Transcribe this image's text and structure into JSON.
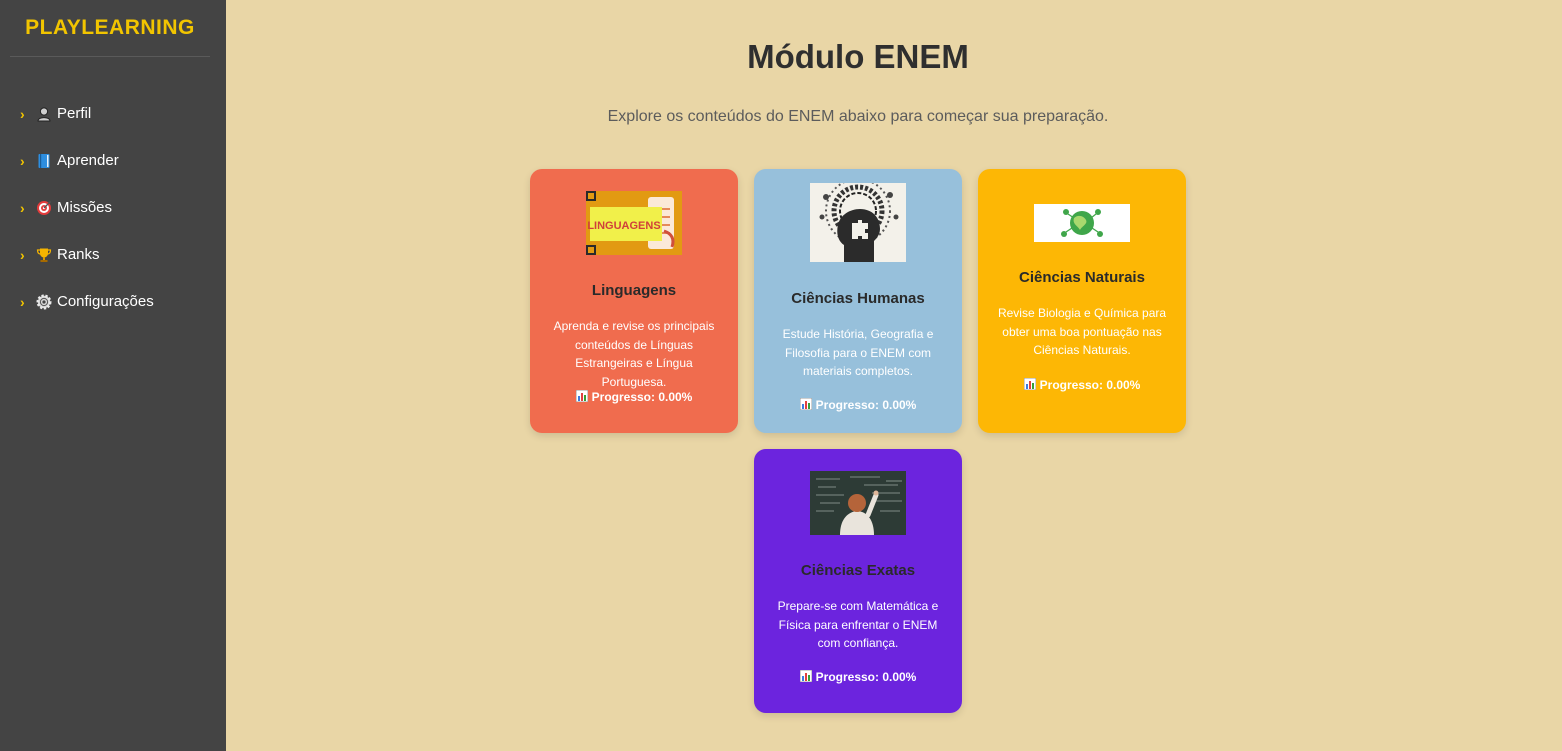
{
  "brand": "PLAYLEARNING",
  "nav": {
    "items": [
      {
        "arrow": "›",
        "icon": "profile-icon",
        "label": "Perfil"
      },
      {
        "arrow": "›",
        "icon": "book-icon",
        "label": "Aprender"
      },
      {
        "arrow": "›",
        "icon": "target-icon",
        "label": "Missões"
      },
      {
        "arrow": "›",
        "icon": "trophy-icon",
        "label": "Ranks"
      },
      {
        "arrow": "›",
        "icon": "gear-icon",
        "label": "Configurações"
      }
    ]
  },
  "page": {
    "title": "Módulo ENEM",
    "subtitle": "Explore os conteúdos do ENEM abaixo para começar sua preparação."
  },
  "cards": [
    {
      "title": "Linguagens",
      "image_text": "LINGUAGENS",
      "description": "Aprenda e revise os principais conteúdos de Línguas Estrangeiras e Língua Portuguesa.",
      "progress": "Progresso: 0.00%",
      "color": "#f06c4e"
    },
    {
      "title": "Ciências Humanas",
      "description": "Estude História, Geografia e Filosofia para o ENEM com materiais completos.",
      "progress": "Progresso: 0.00%",
      "color": "#97c0db"
    },
    {
      "title": "Ciências Naturais",
      "description": "Revise Biologia e Química para obter uma boa pontuação nas Ciências Naturais.",
      "progress": "Progresso: 0.00%",
      "color": "#fdb705"
    },
    {
      "title": "Ciências Exatas",
      "description": "Prepare-se com Matemática e Física para enfrentar o ENEM com confiança.",
      "progress": "Progresso: 0.00%",
      "color": "#6c24de"
    }
  ],
  "colors": {
    "sidebar": "#444444",
    "brand": "#f2c500",
    "background": "#e9d6a6"
  }
}
